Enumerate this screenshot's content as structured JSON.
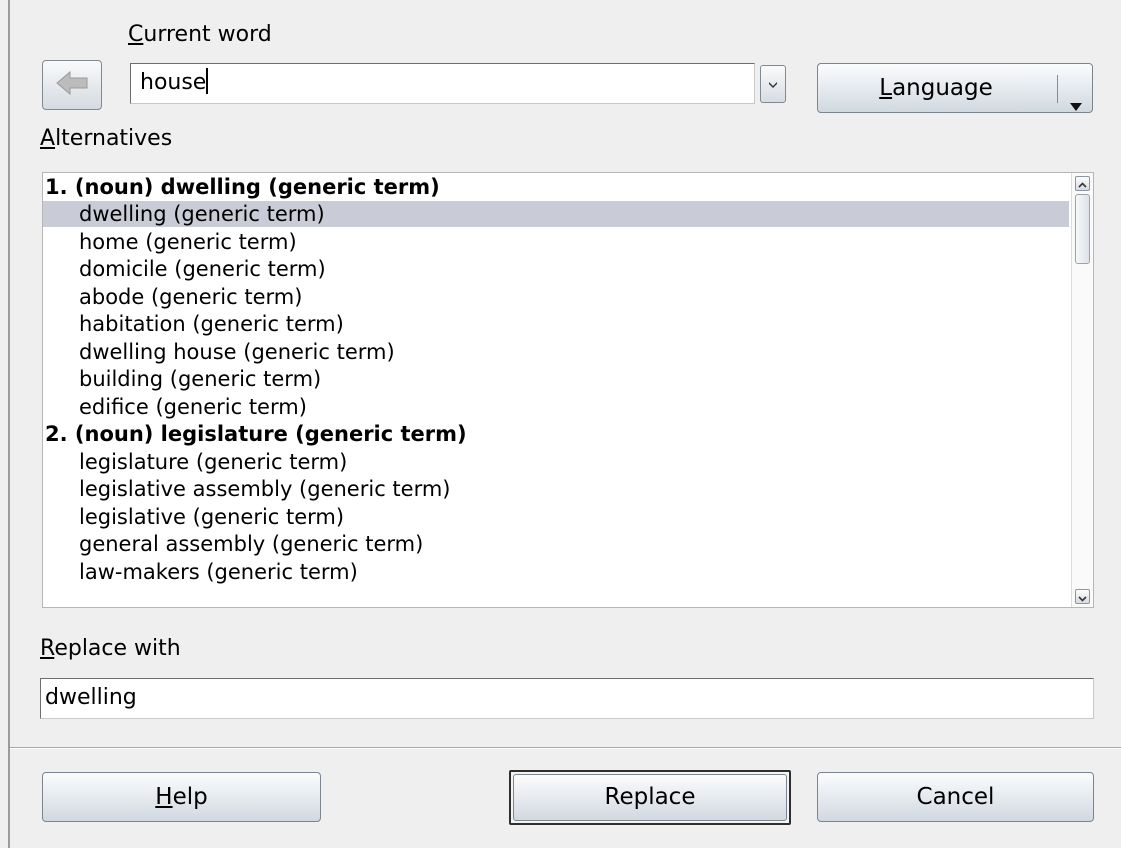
{
  "current_word": {
    "label_accel": "C",
    "label_rest": "urrent word",
    "value": "house"
  },
  "language_button": {
    "label_accel": "L",
    "label_rest": "anguage"
  },
  "alternatives": {
    "label_accel": "A",
    "label_rest": "lternatives",
    "items": [
      {
        "text": "1. (noun) dwelling (generic term)",
        "heading": true,
        "selected": false
      },
      {
        "text": "dwelling (generic term)",
        "heading": false,
        "selected": true
      },
      {
        "text": "home (generic term)",
        "heading": false,
        "selected": false
      },
      {
        "text": "domicile (generic term)",
        "heading": false,
        "selected": false
      },
      {
        "text": "abode (generic term)",
        "heading": false,
        "selected": false
      },
      {
        "text": "habitation (generic term)",
        "heading": false,
        "selected": false
      },
      {
        "text": "dwelling house (generic term)",
        "heading": false,
        "selected": false
      },
      {
        "text": "building (generic term)",
        "heading": false,
        "selected": false
      },
      {
        "text": "edifice (generic term)",
        "heading": false,
        "selected": false
      },
      {
        "text": "2. (noun) legislature (generic term)",
        "heading": true,
        "selected": false
      },
      {
        "text": "legislature (generic term)",
        "heading": false,
        "selected": false
      },
      {
        "text": "legislative assembly (generic term)",
        "heading": false,
        "selected": false
      },
      {
        "text": "legislative (generic term)",
        "heading": false,
        "selected": false
      },
      {
        "text": "general assembly (generic term)",
        "heading": false,
        "selected": false
      },
      {
        "text": "law-makers (generic term)",
        "heading": false,
        "selected": false
      }
    ]
  },
  "replace_with": {
    "label_accel": "R",
    "label_rest": "eplace with",
    "value": "dwelling"
  },
  "buttons": {
    "help_accel": "H",
    "help_rest": "elp",
    "replace": "Replace",
    "cancel": "Cancel"
  },
  "icons": {
    "back": "left-arrow-icon",
    "dropdown": "chevron-down-icon",
    "language_dropdown": "triangle-down-icon",
    "scroll_up": "chevron-up-icon",
    "scroll_down": "chevron-down-icon"
  },
  "colors": {
    "selection": "#c9ccd6",
    "dialog_bg": "#efefef"
  }
}
